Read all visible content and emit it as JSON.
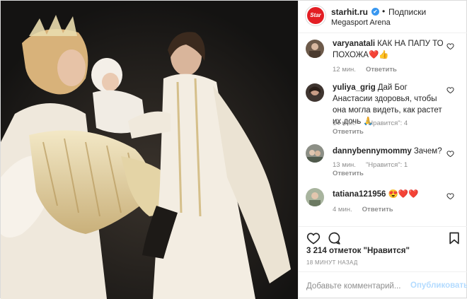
{
  "header": {
    "account": "starhit.ru",
    "separator": "•",
    "follow_label": "Подписки",
    "location": "Megasport Arena",
    "avatar_text": "Star",
    "verified_mark": "✔"
  },
  "comments": [
    {
      "user": "varyanatali",
      "text": "КАК НА ПАПУ ТО ПОХОЖА",
      "emoji": "❤️👍",
      "time": "12 мин.",
      "likes": "",
      "reply": "Ответить"
    },
    {
      "user": "yuliya_grig",
      "text": "Дай Бог Анастасии здоровья, чтобы она могла видеть, как растет их дочь",
      "emoji": "🙏",
      "time": "14 мин.",
      "likes": "\"Нравится\": 4",
      "reply": "Ответить"
    },
    {
      "user": "dannybennymommy",
      "text": "Зачем?",
      "emoji": "",
      "time": "13 мин.",
      "likes": "\"Нравится\": 1",
      "reply": "Ответить"
    },
    {
      "user": "tatiana121956",
      "text": "",
      "emoji": "😍❤️❤️",
      "time": "4 мин.",
      "likes": "",
      "reply": "Ответить"
    }
  ],
  "actions": {
    "like_icon": "heart-icon",
    "comment_icon": "comment-icon",
    "save_icon": "bookmark-icon"
  },
  "likes_text": "3 214 отметок \"Нравится\"",
  "posted_ago": "18 МИНУТ НАЗАД",
  "composer": {
    "placeholder": "Добавьте комментарий...",
    "publish_label": "Опубликовать"
  },
  "colors": {
    "brand_red": "#e31e24",
    "verified_blue": "#3897f0",
    "publish_disabled": "#b3dbff",
    "heart_red": "#ed4956"
  }
}
